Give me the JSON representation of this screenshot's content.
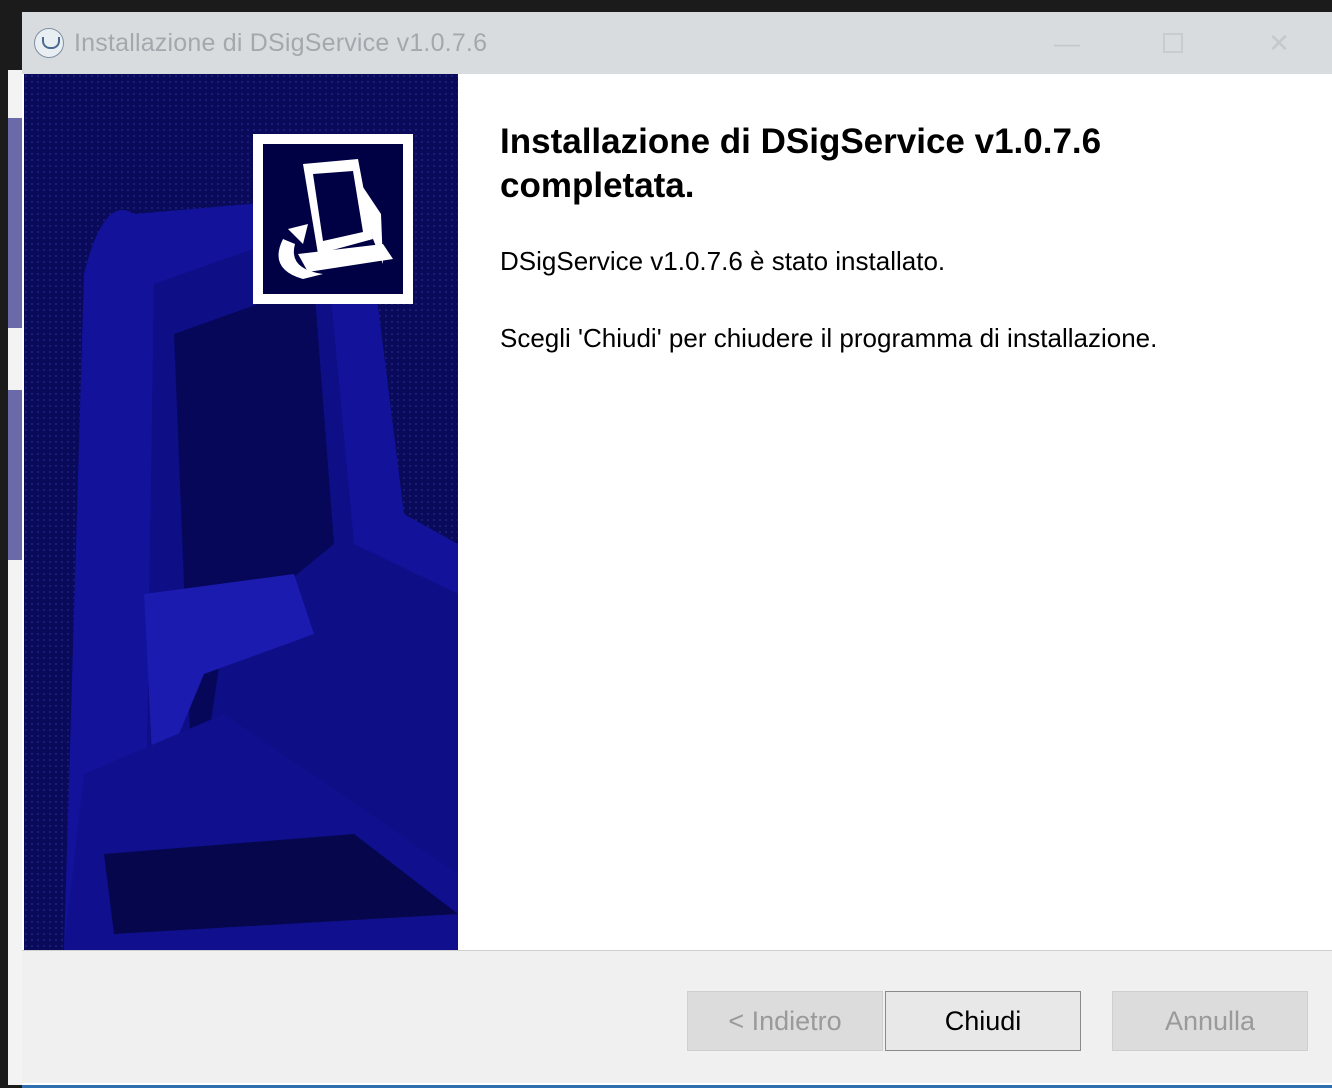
{
  "window": {
    "title": "Installazione di DSigService v1.0.7.6",
    "controls": {
      "minimize": "—",
      "close": "✕"
    }
  },
  "content": {
    "heading": "Installazione di DSigService v1.0.7.6 completata.",
    "message": "DSigService v1.0.7.6 è stato installato.",
    "instruction": "Scegli 'Chiudi' per chiudere il programma di installazione."
  },
  "buttons": {
    "back": "< Indietro",
    "close": "Chiudi",
    "cancel": "Annulla"
  },
  "colors": {
    "sidebar": "#0a0a5a",
    "accent_border": "#2f6fb0"
  },
  "icons": {
    "app": "installer-icon",
    "sidebar_logo": "computer-install-icon"
  }
}
